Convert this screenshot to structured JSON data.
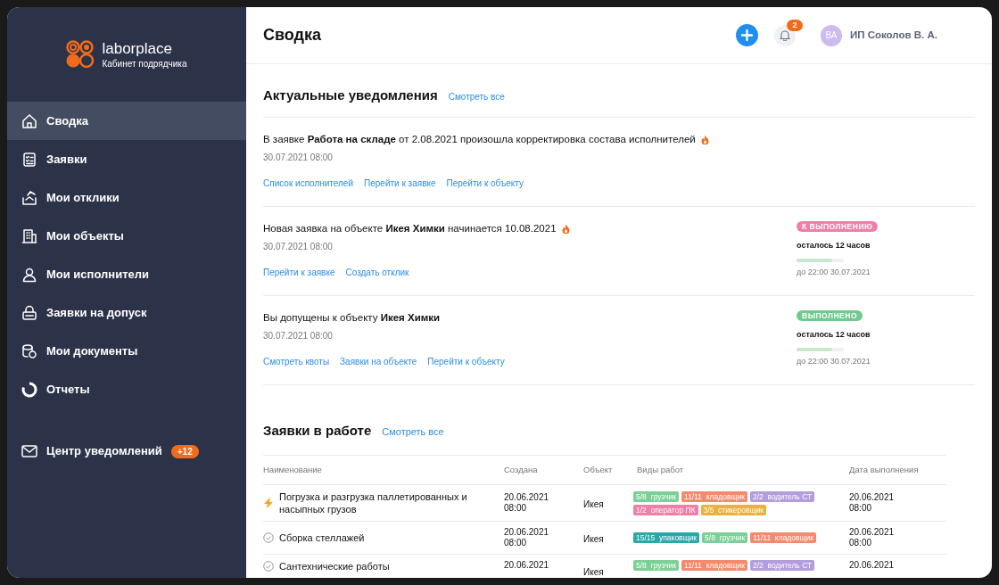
{
  "sidebar": {
    "logo": {
      "name": "laborplace",
      "subtitle": "Кабинет подрядчика"
    },
    "items": [
      {
        "label": "Сводка",
        "selected": true
      },
      {
        "label": "Заявки",
        "selected": false
      },
      {
        "label": "Мои отклики",
        "selected": false
      },
      {
        "label": "Мои объекты",
        "selected": false
      },
      {
        "label": "Мои исполнители",
        "selected": false
      },
      {
        "label": "Заявки на допуск",
        "selected": false
      },
      {
        "label": "Мои документы",
        "selected": false
      },
      {
        "label": "Отчеты",
        "selected": false
      }
    ],
    "notification_center": {
      "label": "Центр уведомлений",
      "badge": "+12"
    }
  },
  "header": {
    "title": "Сводка",
    "bell_badge": "2",
    "user": {
      "initials": "ВА",
      "name": "ИП Соколов В. А."
    }
  },
  "notifications": {
    "title": "Актуальные уведомления",
    "see_all": "Смотреть все",
    "items": [
      {
        "text": "В заявке **Работа на складе** от 2.08.2021 произошла корректировка состава исполнителей",
        "hot": true,
        "time": "30.07.2021 08:00",
        "links": [
          "Список исполнителей",
          "Перейти к заявке",
          "Перейти к объекту"
        ]
      },
      {
        "text": "Новая заявка на объекте **Икея Химки** начинается 10.08.2021",
        "hot": true,
        "time": "30.07.2021 08:00",
        "links": [
          "Перейти к заявке",
          "Создать отклик"
        ],
        "status": {
          "label": "К ВЫПОЛНЕНИЮ",
          "kind": "pending",
          "remaining": "осталось 12 часов",
          "level": 0.75,
          "deadline": "до 22:00 30.07.2021"
        }
      },
      {
        "text": "Вы допущены к объекту **Икея Химки**",
        "hot": false,
        "time": "30.07.2021 08:00",
        "links": [
          "Смотреть квоты",
          "Заявки на объекте",
          "Перейти к объекту"
        ],
        "status": {
          "label": "ВЫПОЛНЕНО",
          "kind": "done",
          "remaining": "осталось 12 часов",
          "level": 0.75,
          "deadline": "до 22:00 30.07.2021"
        }
      }
    ]
  },
  "orders": {
    "title": "Заявки в работе",
    "see_all": "Смотреть все",
    "columns": [
      "Наименование",
      "Создана",
      "Объект",
      "Виды работ",
      "Дата выполнения"
    ],
    "rows": [
      {
        "kind": "urgent",
        "name": "Погрузка и разгрузка паллетированных и насыпных грузов",
        "created": [
          "20.06.2021",
          "08:00"
        ],
        "object": "Икея",
        "tags": [
          {
            "count": "5/8",
            "label": "грузчик",
            "color": "#7ccf96"
          },
          {
            "count": "11/11",
            "label": "кладовщик",
            "color": "#f38a6d"
          },
          {
            "count": "2/2",
            "label": "водитель СТ",
            "color": "#b39ddb"
          },
          {
            "count": "1/2",
            "label": "оператор ПК",
            "color": "#f07fa8"
          },
          {
            "count": "3/5",
            "label": "стикеровщик",
            "color": "#e8b23c"
          }
        ],
        "due": [
          "20.06.2021",
          "08:00"
        ]
      },
      {
        "kind": "done",
        "name": "Сборка стеллажей",
        "created": [
          "20.06.2021",
          "08:00"
        ],
        "object": "Икея",
        "tags": [
          {
            "count": "15/15",
            "label": "упаковщик",
            "color": "#2aa7a7"
          },
          {
            "count": "5/8",
            "label": "грузчик",
            "color": "#7ccf96"
          },
          {
            "count": "11/11",
            "label": "кладовщик",
            "color": "#f38a6d"
          }
        ],
        "due": [
          "20.06.2021",
          "08:00"
        ]
      },
      {
        "kind": "done",
        "name": "Сантехнические работы",
        "created": [
          "20.06.2021"
        ],
        "object": "Икея",
        "tags": [
          {
            "count": "5/8",
            "label": "грузчик",
            "color": "#7ccf96"
          },
          {
            "count": "11/11",
            "label": "кладовщик",
            "color": "#f38a6d"
          },
          {
            "count": "2/2",
            "label": "водитель СТ",
            "color": "#b39ddb"
          }
        ],
        "due": [
          "20.06.2021"
        ]
      }
    ]
  }
}
